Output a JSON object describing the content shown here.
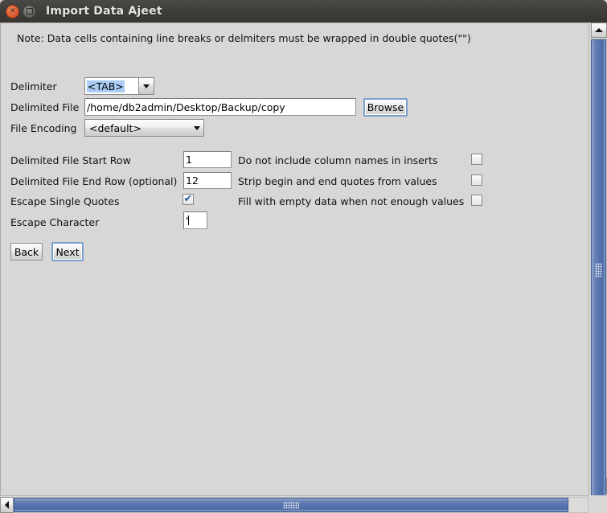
{
  "window": {
    "title": "Import Data Ajeet",
    "close_icon": "close-icon",
    "maximize_icon": "maximize-icon"
  },
  "note": "Note: Data cells containing line breaks or delmiters must be wrapped in double quotes(\"\")",
  "form": {
    "delimiter": {
      "label": "Delimiter",
      "value": "<TAB>",
      "arrow_icon": "chevron-down-icon"
    },
    "delimited_file": {
      "label": "Delimited File",
      "value": "/home/db2admin/Desktop/Backup/copy",
      "browse_label": "Browse"
    },
    "file_encoding": {
      "label": "File Encoding",
      "value": "<default>",
      "arrow_icon": "chevron-down-icon"
    },
    "start_row": {
      "label": "Delimited File Start Row",
      "value": "1"
    },
    "end_row": {
      "label": "Delimited File End Row (optional)",
      "value": "12"
    },
    "escape_single_quotes": {
      "label": "Escape Single Quotes",
      "checked": true,
      "check_glyph": "✔"
    },
    "escape_character": {
      "label": "Escape Character",
      "value": "'"
    },
    "no_column_names": {
      "label": "Do not include column names in inserts",
      "checked": false
    },
    "strip_quotes": {
      "label": "Strip begin and end quotes from values",
      "checked": false
    },
    "fill_empty": {
      "label": "Fill with empty data when not enough values",
      "checked": false
    }
  },
  "buttons": {
    "back": "Back",
    "next": "Next"
  },
  "scrollbars": {
    "up_icon": "triangle-up-icon",
    "down_icon": "triangle-down-icon",
    "left_icon": "triangle-left-icon",
    "right_icon": "triangle-right-icon"
  },
  "colors": {
    "accent": "#5774ad",
    "selection": "#aacdf5",
    "panel": "#d8d7d5",
    "titlebar": "#3f3d39",
    "close_button": "#e2613a"
  }
}
